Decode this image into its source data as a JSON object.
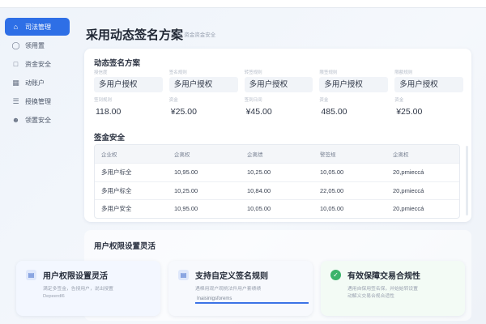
{
  "sidebar": {
    "items": [
      {
        "label": "司法管理",
        "icon": "home-icon",
        "active": true
      },
      {
        "label": "领用置",
        "icon": "user-icon"
      },
      {
        "label": "资金安全",
        "icon": "document-icon"
      },
      {
        "label": "动账户",
        "icon": "calendar-icon"
      },
      {
        "label": "授换管理",
        "icon": "list-icon"
      },
      {
        "label": "领置安全",
        "icon": "person-icon"
      }
    ]
  },
  "header": {
    "title": "采用动态签名方案",
    "breadcrumb": "资金资金安全"
  },
  "scheme": {
    "title": "动态签名方案",
    "row1": [
      {
        "label": "授信度",
        "value": "多用户授权"
      },
      {
        "label": "签名规则",
        "value": "多用户授权"
      },
      {
        "label": "转签规则",
        "value": "多用户授权"
      },
      {
        "label": "限签规则",
        "value": "多用户授权"
      },
      {
        "label": "限额规则",
        "value": "多用户授权"
      }
    ],
    "row2": [
      {
        "label": "签到规则",
        "value": "118.00"
      },
      {
        "label": "资金",
        "value": "¥25.00"
      },
      {
        "label": "签到日间",
        "value": "¥45.00"
      },
      {
        "label": "资金",
        "value": "485.00"
      },
      {
        "label": "资金",
        "value": "¥25.00"
      }
    ]
  },
  "security": {
    "title": "签金安全",
    "columns": [
      "企业权",
      "企离权",
      "企离绩",
      "警签规",
      "企离权"
    ],
    "rows": [
      [
        "多用户标全",
        "10,95.00",
        "10,25.00",
        "10,05.00",
        "20,pmieccá"
      ],
      [
        "多用户标全",
        "10,25.00",
        "10,84.00",
        "22,05.00",
        "20,pmieccá"
      ],
      [
        "多用户安全",
        "10,95.00",
        "10,05.00",
        "10,05.00",
        "20,pmieccá"
      ]
    ]
  },
  "lower": {
    "title": "用户权限设置灵活"
  },
  "features": [
    {
      "title": "用户权限设置灵活",
      "icon": "document-icon",
      "desc1": "满定多签金，告授用户，说出授置",
      "desc2": "Depeerdl6"
    },
    {
      "title": "支持自定义签名规则",
      "icon": "document-icon",
      "desc1": "遇棉用观户观桃法件用户套绩绩",
      "input": "Inaisinigsforems"
    },
    {
      "title": "有效保障交易合规性",
      "icon": "check-circle-icon",
      "desc1": "遇用自保用签名保，并始始转设置",
      "desc2": "动解义交易合规合适性"
    }
  ],
  "colors": {
    "accent": "#2e6fe6",
    "success": "#3bb36a"
  }
}
